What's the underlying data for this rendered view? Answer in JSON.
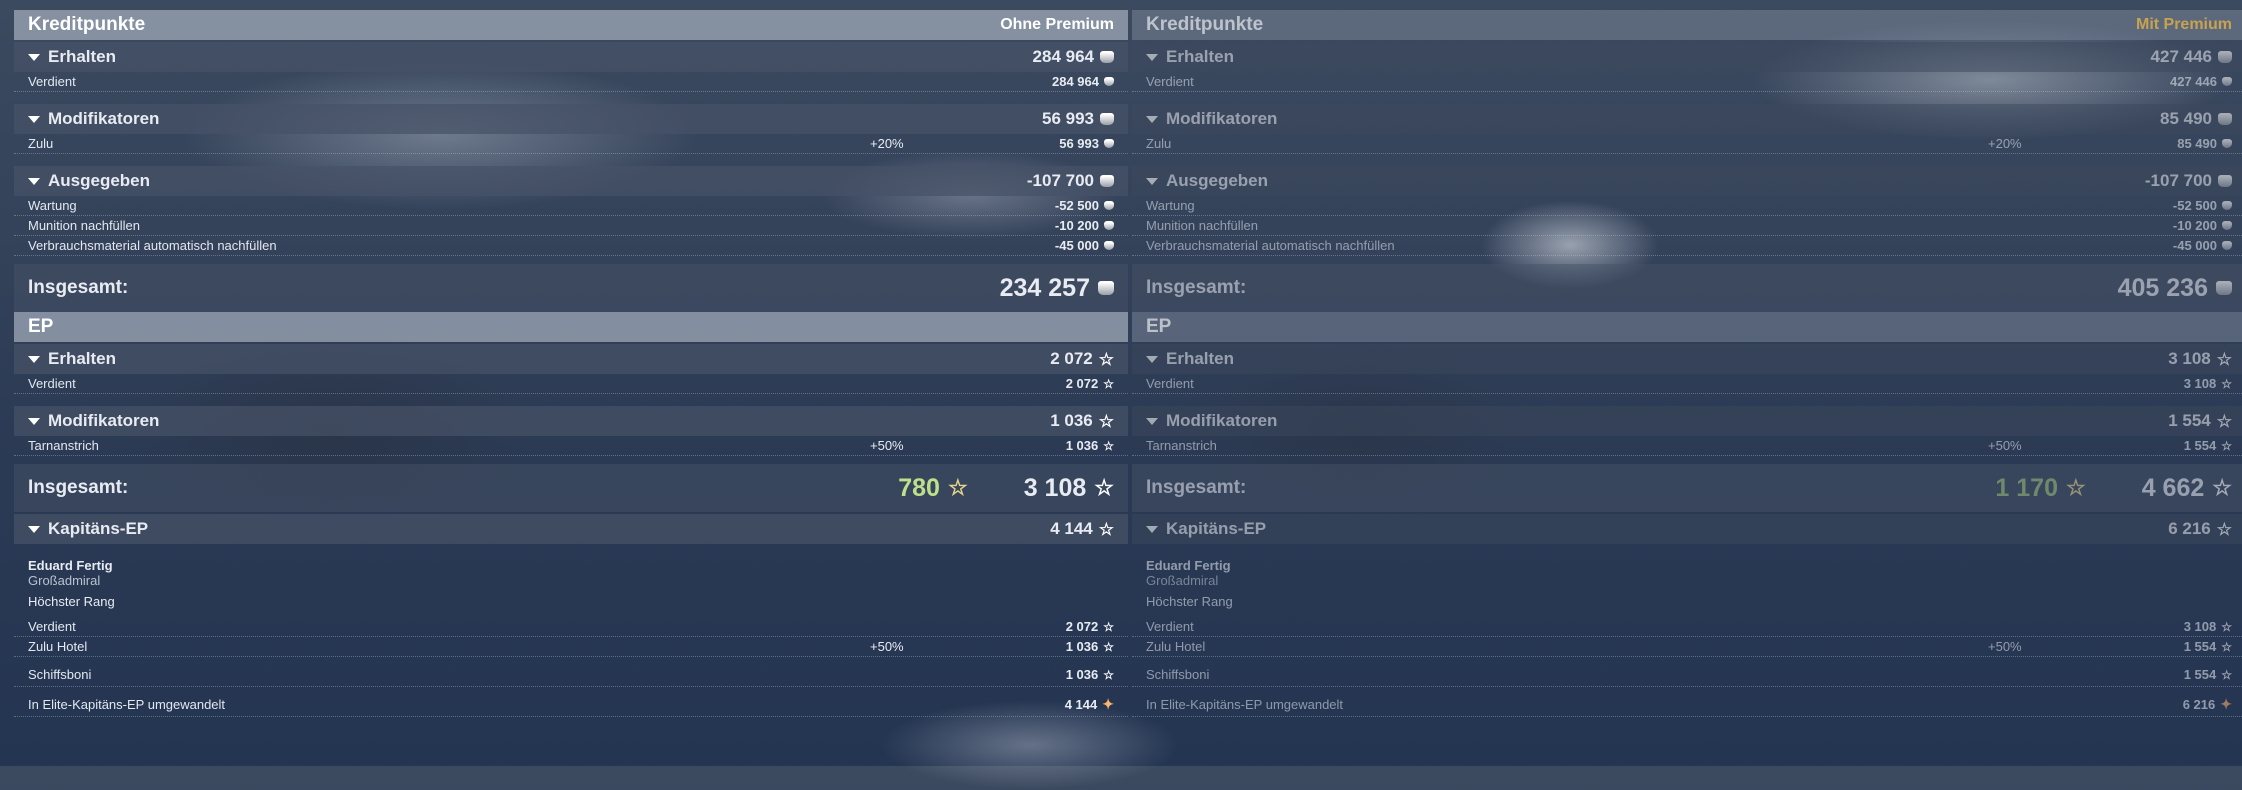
{
  "columns": [
    {
      "credits": {
        "title": "Kreditpunkte",
        "subtitle": "Ohne Premium",
        "received": {
          "label": "Erhalten",
          "value": "284 964",
          "rows": [
            {
              "label": "Verdient",
              "value": "284 964"
            }
          ]
        },
        "modifiers": {
          "label": "Modifikatoren",
          "value": "56 993",
          "rows": [
            {
              "label": "Zulu",
              "pct": "+20%",
              "value": "56 993"
            }
          ]
        },
        "spent": {
          "label": "Ausgegeben",
          "value": "-107 700",
          "rows": [
            {
              "label": "Wartung",
              "value": "-52 500"
            },
            {
              "label": "Munition nachfüllen",
              "value": "-10 200"
            },
            {
              "label": "Verbrauchsmaterial automatisch nachfüllen",
              "value": "-45 000"
            }
          ]
        },
        "total": {
          "label": "Insgesamt:",
          "value": "234 257"
        }
      },
      "xp": {
        "title": "EP",
        "received": {
          "label": "Erhalten",
          "value": "2 072",
          "rows": [
            {
              "label": "Verdient",
              "value": "2 072"
            }
          ]
        },
        "modifiers": {
          "label": "Modifikatoren",
          "value": "1 036",
          "rows": [
            {
              "label": "Tarnanstrich",
              "pct": "+50%",
              "value": "1 036"
            }
          ]
        },
        "total": {
          "label": "Insgesamt:",
          "free": "780",
          "value": "3 108"
        }
      },
      "captain": {
        "label": "Kapitäns-EP",
        "value": "4 144",
        "name": "Eduard Fertig",
        "rank": "Großadmiral",
        "best": "Höchster Rang",
        "rows": [
          {
            "label": "Verdient",
            "value": "2 072"
          },
          {
            "label": "Zulu Hotel",
            "pct": "+50%",
            "value": "1 036"
          },
          {
            "label": "Schiffsboni",
            "value": "1 036"
          },
          {
            "label": "In Elite-Kapitäns-EP umgewandelt",
            "value": "4 144"
          }
        ]
      }
    },
    {
      "credits": {
        "title": "Kreditpunkte",
        "subtitle": "Mit Premium",
        "received": {
          "label": "Erhalten",
          "value": "427 446",
          "rows": [
            {
              "label": "Verdient",
              "value": "427 446"
            }
          ]
        },
        "modifiers": {
          "label": "Modifikatoren",
          "value": "85 490",
          "rows": [
            {
              "label": "Zulu",
              "pct": "+20%",
              "value": "85 490"
            }
          ]
        },
        "spent": {
          "label": "Ausgegeben",
          "value": "-107 700",
          "rows": [
            {
              "label": "Wartung",
              "value": "-52 500"
            },
            {
              "label": "Munition nachfüllen",
              "value": "-10 200"
            },
            {
              "label": "Verbrauchsmaterial automatisch nachfüllen",
              "value": "-45 000"
            }
          ]
        },
        "total": {
          "label": "Insgesamt:",
          "value": "405 236"
        }
      },
      "xp": {
        "title": "EP",
        "received": {
          "label": "Erhalten",
          "value": "3 108",
          "rows": [
            {
              "label": "Verdient",
              "value": "3 108"
            }
          ]
        },
        "modifiers": {
          "label": "Modifikatoren",
          "value": "1 554",
          "rows": [
            {
              "label": "Tarnanstrich",
              "pct": "+50%",
              "value": "1 554"
            }
          ]
        },
        "total": {
          "label": "Insgesamt:",
          "free": "1 170",
          "value": "4 662"
        }
      },
      "captain": {
        "label": "Kapitäns-EP",
        "value": "6 216",
        "name": "Eduard Fertig",
        "rank": "Großadmiral",
        "best": "Höchster Rang",
        "rows": [
          {
            "label": "Verdient",
            "value": "3 108"
          },
          {
            "label": "Zulu Hotel",
            "pct": "+50%",
            "value": "1 554"
          },
          {
            "label": "Schiffsboni",
            "value": "1 554"
          },
          {
            "label": "In Elite-Kapitäns-EP umgewandelt",
            "value": "6 216"
          }
        ]
      }
    }
  ],
  "icons": {
    "credits": "credit-coin-icon",
    "xp": "xp-star-icon",
    "free_xp": "free-xp-star-icon",
    "elite": "elite-captain-xp-icon",
    "expand": "collapse-triangle-icon"
  },
  "colors": {
    "premium_label": "#c8a24e",
    "free_xp": "#bfe08a"
  }
}
